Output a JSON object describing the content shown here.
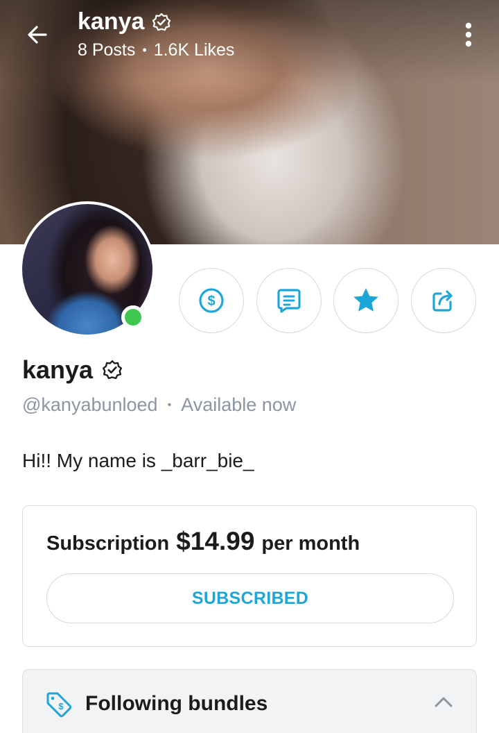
{
  "header": {
    "name": "kanya",
    "posts": "8 Posts",
    "separator": "•",
    "likes": "1.6K Likes"
  },
  "profile": {
    "name": "kanya",
    "handle": "@kanyabunloed",
    "separator": "•",
    "status": "Available now",
    "bio": "Hi!! My name is _barr_bie_",
    "online": true
  },
  "actions": [
    {
      "icon": "dollar-icon"
    },
    {
      "icon": "message-icon"
    },
    {
      "icon": "star-icon"
    },
    {
      "icon": "share-icon"
    }
  ],
  "subscription": {
    "label": "Subscription",
    "price": "$14.99",
    "period": "per month",
    "button_label": "SUBSCRIBED"
  },
  "bundles": {
    "label": "Following bundles",
    "expanded": true
  },
  "colors": {
    "accent": "#1fa6d8",
    "online": "#3fc74f",
    "muted_text": "#8a96a3"
  }
}
